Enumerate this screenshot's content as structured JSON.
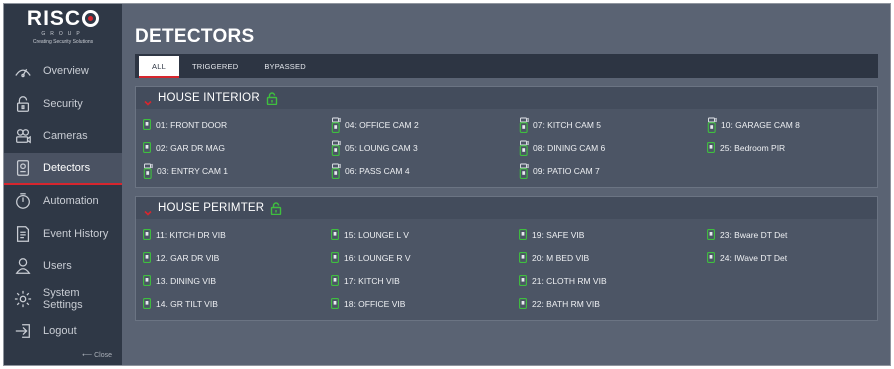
{
  "brand": {
    "name_left": "RISC",
    "group": "GROUP",
    "tagline": "Creating Security Solutions",
    "accent_color": "#d7262e"
  },
  "sidebar": {
    "items": [
      {
        "label": "Overview",
        "icon": "overview-icon"
      },
      {
        "label": "Security",
        "icon": "lock-icon"
      },
      {
        "label": "Cameras",
        "icon": "camera-icon"
      },
      {
        "label": "Detectors",
        "icon": "detector-icon",
        "active": true
      },
      {
        "label": "Automation",
        "icon": "automation-icon"
      },
      {
        "label": "Event History",
        "icon": "history-icon"
      },
      {
        "label": "Users",
        "icon": "user-icon"
      },
      {
        "label": "System Settings",
        "icon": "gear-icon"
      },
      {
        "label": "Logout",
        "icon": "logout-icon"
      }
    ],
    "close_label": "⟵ Close"
  },
  "main": {
    "title": "DETECTORS",
    "tabs": [
      {
        "label": "ALL",
        "active": true
      },
      {
        "label": "TRIGGERED"
      },
      {
        "label": "BYPASSED"
      }
    ],
    "groups": [
      {
        "title": "HOUSE INTERIOR",
        "status_color": "#3fbf3f",
        "detectors": [
          {
            "label": "01: FRONT DOOR",
            "type": "sensor"
          },
          {
            "label": "04: OFFICE CAM 2",
            "type": "camera"
          },
          {
            "label": "07: KITCH CAM 5",
            "type": "camera"
          },
          {
            "label": "10: GARAGE CAM 8",
            "type": "camera"
          },
          {
            "label": "02: GAR DR MAG",
            "type": "sensor"
          },
          {
            "label": "05: LOUNG CAM 3",
            "type": "camera"
          },
          {
            "label": "08: DINING CAM 6",
            "type": "camera"
          },
          {
            "label": "25: Bedroom PIR",
            "type": "sensor"
          },
          {
            "label": "03: ENTRY CAM 1",
            "type": "camera"
          },
          {
            "label": "06: PASS CAM 4",
            "type": "camera"
          },
          {
            "label": "09: PATIO CAM 7",
            "type": "camera"
          }
        ]
      },
      {
        "title": "HOUSE PERIMTER",
        "status_color": "#3fbf3f",
        "detectors": [
          {
            "label": "11: KITCH DR VIB",
            "type": "sensor"
          },
          {
            "label": "15: LOUNGE L V",
            "type": "sensor"
          },
          {
            "label": "19: SAFE VIB",
            "type": "sensor"
          },
          {
            "label": "23: Bware DT Det",
            "type": "sensor"
          },
          {
            "label": "12. GAR DR VIB",
            "type": "sensor"
          },
          {
            "label": "16: LOUNGE R V",
            "type": "sensor"
          },
          {
            "label": "20: M BED VIB",
            "type": "sensor"
          },
          {
            "label": "24: IWave DT Det",
            "type": "sensor"
          },
          {
            "label": "13. DINING VIB",
            "type": "sensor"
          },
          {
            "label": "17: KITCH VIB",
            "type": "sensor"
          },
          {
            "label": "21: CLOTH RM VIB",
            "type": "sensor"
          },
          {
            "label": "",
            "type": "empty"
          },
          {
            "label": "14. GR TILT VIB",
            "type": "sensor"
          },
          {
            "label": "18: OFFICE VIB",
            "type": "sensor"
          },
          {
            "label": "22: BATH RM VIB",
            "type": "sensor"
          }
        ]
      }
    ]
  }
}
